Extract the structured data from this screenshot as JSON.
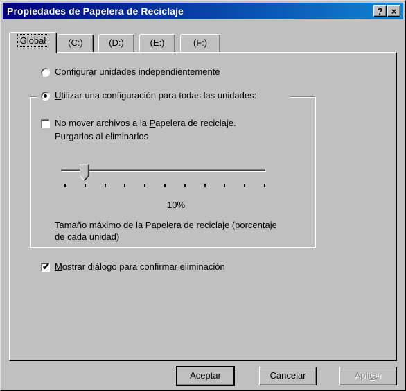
{
  "window": {
    "title": "Propiedades de Papelera de Reciclaje",
    "help_glyph": "?",
    "close_glyph": "×"
  },
  "tabs": [
    {
      "label": "Global",
      "active": true
    },
    {
      "label": "(C:)",
      "active": false
    },
    {
      "label": "(D:)",
      "active": false
    },
    {
      "label": "(E:)",
      "active": false
    },
    {
      "label": "(F:)",
      "active": false
    }
  ],
  "options": {
    "independent": {
      "pre": "Configurar unidades ",
      "accel": "i",
      "post": "ndependientemente",
      "selected": false
    },
    "single": {
      "pre": "",
      "accel": "U",
      "post": "tilizar una configuración para todas las unidades:",
      "selected": true
    }
  },
  "group": {
    "no_move": {
      "line1_pre": "No mover archivos a la ",
      "line1_accel": "P",
      "line1_post": "apelera de reciclaje.",
      "line2": "Purgarlos al eliminarlos",
      "checked": false
    },
    "slider": {
      "value_label": "10%",
      "value_percent": 10,
      "tick_count": 11
    },
    "max_size": {
      "line1_accel": "T",
      "line1_post": "amaño máximo de la Papelera de reciclaje (porcentaje",
      "line2": "de cada unidad)"
    }
  },
  "confirm": {
    "accel": "M",
    "post": "ostrar diálogo para confirmar eliminación",
    "checked": true,
    "mark": "✔"
  },
  "buttons": {
    "ok": "Aceptar",
    "cancel": "Cancelar",
    "apply_pre": "Apli",
    "apply_accel": "c",
    "apply_post": "ar"
  }
}
